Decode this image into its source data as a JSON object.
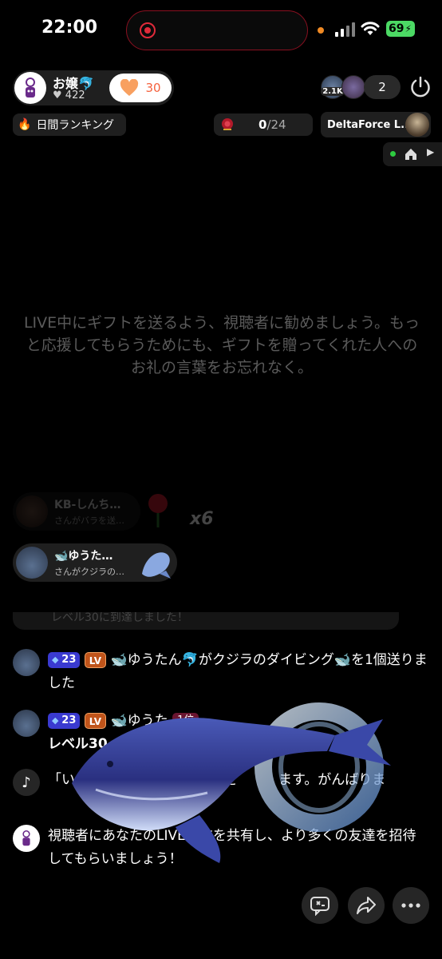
{
  "status": {
    "time": "22:00",
    "battery": "69"
  },
  "host": {
    "name": "お嬢🐬",
    "likes": "422",
    "follow_count": "30"
  },
  "viewers": {
    "top_badge": "2.1K",
    "count": "2"
  },
  "ranking": {
    "label": "日間ランキング"
  },
  "goal": {
    "progress": "0",
    "total": "/24"
  },
  "partner": {
    "name": "DeltaForce L..."
  },
  "hint": "LIVE中にギフトを送るよう、視聴者に勧めましょう。もっと応援してもらうためにも、ギフトを贈ってくれた人へのお礼の言葉をお忘れなく。",
  "gift_notifications": [
    {
      "name": "KB-しんち…",
      "sub": "さんがバラを送…",
      "combo": "x6"
    },
    {
      "name": "🐋ゆうた…",
      "sub": "さんがクジラの…"
    }
  ],
  "chat": {
    "partial": "レベル30に到達しました！",
    "messages": [
      {
        "level": "23",
        "sub": "LV",
        "text": "🐋ゆうたん🐬がクジラのダイビング🐋を1個送りました"
      },
      {
        "level": "23",
        "sub": "LV",
        "name": "🐋ゆうた",
        "rank": "1位",
        "text": "レベル30"
      },
      {
        "text": "「い　　　　　　　　視聴者を　　　ます。がんばりま"
      },
      {
        "text": "視聴者にあなたのLIVE配信を共有し、より多くの友達を招待してもらいましょう！"
      }
    ]
  },
  "colors": {
    "accent": "#f5613d",
    "level_badge": "#3a3ad0",
    "sub_badge": "#c0541a",
    "battery": "#4cd964"
  },
  "icons": [
    "heart-icon",
    "fire-icon",
    "power-icon",
    "tiktok-icon",
    "share-icon",
    "more-icon",
    "comment-icon"
  ]
}
